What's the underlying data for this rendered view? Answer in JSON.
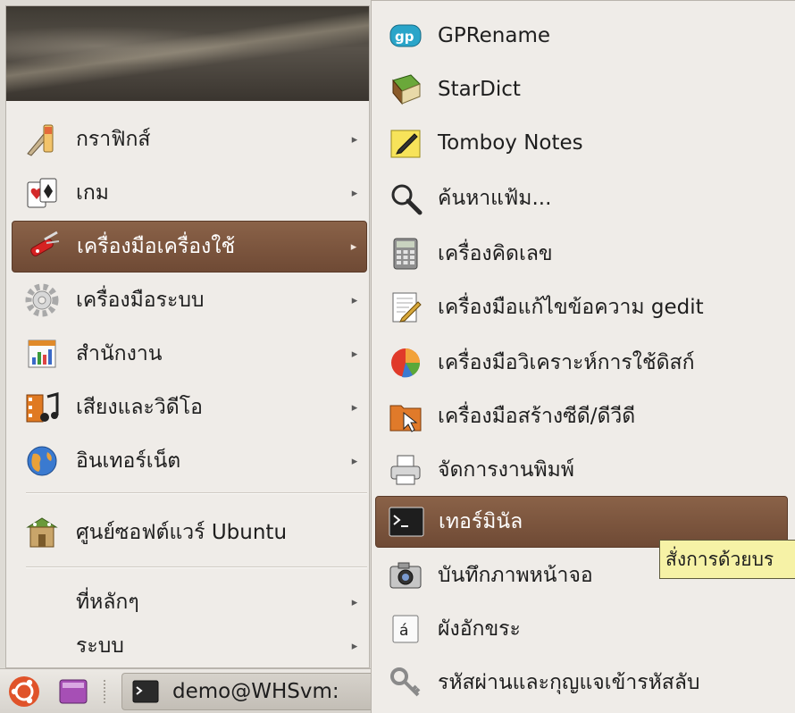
{
  "main_menu": {
    "items": [
      {
        "label": "กราฟิกส์",
        "icon": "graphics-icon",
        "arrow": "▸"
      },
      {
        "label": "เกม",
        "icon": "games-icon",
        "arrow": "▸"
      },
      {
        "label": "เครื่องมือเครื่องใช้",
        "icon": "accessories-icon",
        "arrow": "▸"
      },
      {
        "label": "เครื่องมือระบบ",
        "icon": "system-tools-icon",
        "arrow": "▸"
      },
      {
        "label": "สำนักงาน",
        "icon": "office-icon",
        "arrow": "▸"
      },
      {
        "label": "เสียงและวิดีโอ",
        "icon": "sound-video-icon",
        "arrow": "▸"
      },
      {
        "label": "อินเทอร์เน็ต",
        "icon": "internet-icon",
        "arrow": "▸"
      }
    ],
    "software_center": {
      "label": "ศูนย์ซอฟต์แวร์ Ubuntu",
      "icon": "software-center-icon"
    },
    "places": {
      "label": "ที่หลักๆ",
      "arrow": "▸"
    },
    "system": {
      "label": "ระบบ",
      "arrow": "▸"
    }
  },
  "submenu": {
    "items": [
      {
        "label": "GPRename",
        "icon": "gprename-icon"
      },
      {
        "label": "StarDict",
        "icon": "stardict-icon"
      },
      {
        "label": "Tomboy Notes",
        "icon": "tomboy-notes-icon"
      },
      {
        "label": "ค้นหาแฟ้ม...",
        "icon": "search-icon"
      },
      {
        "label": "เครื่องคิดเลข",
        "icon": "calculator-icon"
      },
      {
        "label": "เครื่องมือแก้ไขข้อความ gedit",
        "icon": "text-editor-icon"
      },
      {
        "label": "เครื่องมือวิเคราะห์การใช้ดิสก์",
        "icon": "disk-usage-icon"
      },
      {
        "label": "เครื่องมือสร้างซีดี/ดีวีดี",
        "icon": "cd-burner-icon"
      },
      {
        "label": "จัดการงานพิมพ์",
        "icon": "printer-icon"
      },
      {
        "label": "เทอร์มินัล",
        "icon": "terminal-icon"
      },
      {
        "label": "บันทึกภาพหน้าจอ",
        "icon": "camera-icon"
      },
      {
        "label": "ผังอักขระ",
        "icon": "character-map-icon"
      },
      {
        "label": "รหัสผ่านและกุญแจเข้ารหัสลับ",
        "icon": "keys-icon"
      }
    ]
  },
  "tooltip": {
    "text": "สั่งการด้วยบร"
  },
  "panel": {
    "task_label": "demo@WHSvm:",
    "task_icon": "terminal-icon",
    "launcher_icon": "ubuntu-menu-icon",
    "workspace_icon": "workspace-icon"
  },
  "colors": {
    "selection": "#7a5540",
    "menu_bg": "#efece8",
    "tooltip_bg": "#f6f2a6"
  }
}
